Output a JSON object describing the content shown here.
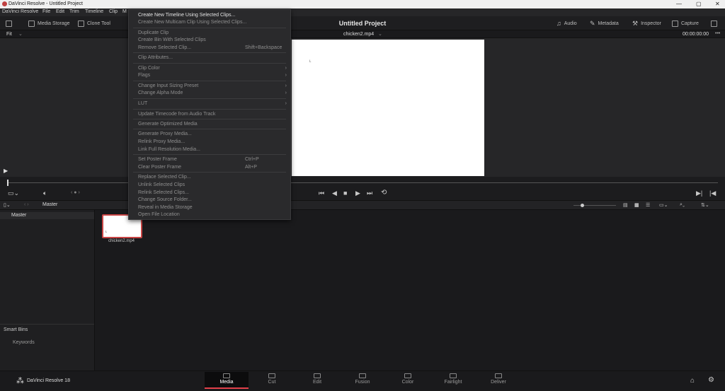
{
  "window": {
    "title": "DaVinci Resolve - Untitled Project",
    "minimize": "—",
    "maximize": "▢",
    "close": "✕"
  },
  "menu": [
    "DaVinci Resolve",
    "File",
    "Edit",
    "Trim",
    "Timeline",
    "Clip",
    "M"
  ],
  "toolbar": {
    "media_storage": "Media Storage",
    "clone_tool": "Clone Tool",
    "project_title": "Untitled Project",
    "audio": "Audio",
    "metadata": "Metadata",
    "inspector": "Inspector",
    "capture": "Capture"
  },
  "viewer": {
    "fit": "Fit",
    "clip_name": "chicken2.mp4",
    "timecode": "00:00:00:00"
  },
  "binbar": {
    "master": "Master"
  },
  "sidebar": {
    "master": "Master",
    "smart_bins": "Smart Bins",
    "keywords": "Keywords"
  },
  "clip": {
    "name": "chicken2.mp4"
  },
  "bottom": {
    "app_name": "DaVinci Resolve 18",
    "tabs": [
      "Media",
      "Cut",
      "Edit",
      "Fusion",
      "Color",
      "Fairlight",
      "Deliver"
    ]
  },
  "context_menu": [
    {
      "label": "Create New Timeline Using Selected Clips...",
      "enabled": true
    },
    {
      "label": "Create New Multicam Clip Using Selected Clips...",
      "enabled": false
    },
    {
      "label": "Duplicate Clip",
      "enabled": false
    },
    {
      "label": "Create Bin With Selected Clips",
      "enabled": false
    },
    {
      "label": "Remove Selected Clip...",
      "enabled": false,
      "shortcut": "Shift+Backspace"
    },
    {
      "label": "Clip Attributes...",
      "enabled": false
    },
    {
      "label": "Clip Color",
      "enabled": false,
      "submenu": true
    },
    {
      "label": "Flags",
      "enabled": false,
      "submenu": true
    },
    {
      "label": "Change Input Sizing Preset",
      "enabled": false,
      "submenu": true
    },
    {
      "label": "Change Alpha Mode",
      "enabled": false,
      "submenu": true
    },
    {
      "label": "LUT",
      "enabled": false,
      "submenu": true
    },
    {
      "label": "Update Timecode from Audio Track",
      "enabled": false
    },
    {
      "label": "Generate Optimized Media",
      "enabled": false
    },
    {
      "label": "Generate Proxy Media...",
      "enabled": false
    },
    {
      "label": "Relink Proxy Media...",
      "enabled": false
    },
    {
      "label": "Link Full Resolution Media...",
      "enabled": false
    },
    {
      "label": "Set Poster Frame",
      "enabled": false,
      "shortcut": "Ctrl+P"
    },
    {
      "label": "Clear Poster Frame",
      "enabled": false,
      "shortcut": "Alt+P"
    },
    {
      "label": "Replace Selected Clip...",
      "enabled": false
    },
    {
      "label": "Unlink Selected Clips",
      "enabled": false
    },
    {
      "label": "Relink Selected Clips...",
      "enabled": false
    },
    {
      "label": "Change Source Folder...",
      "enabled": false
    },
    {
      "label": "Reveal in Media Storage",
      "enabled": false
    },
    {
      "label": "Open File Location",
      "enabled": false
    }
  ]
}
